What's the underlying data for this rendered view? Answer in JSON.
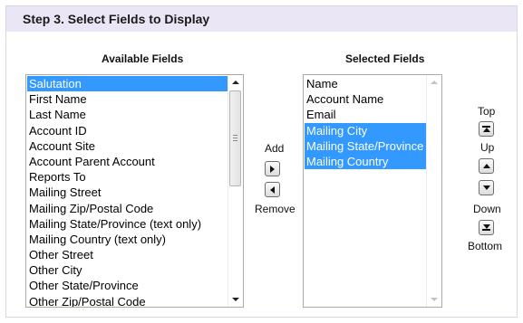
{
  "step": {
    "title": "Step 3. Select Fields to Display"
  },
  "available": {
    "title": "Available Fields",
    "items": [
      "Salutation",
      "First Name",
      "Last Name",
      "Account ID",
      "Account Site",
      "Account Parent Account",
      "Reports To",
      "Mailing Street",
      "Mailing Zip/Postal Code",
      "Mailing State/Province (text only)",
      "Mailing Country (text only)",
      "Other Street",
      "Other City",
      "Other State/Province",
      "Other Zip/Postal Code"
    ],
    "selected_indices": [
      0
    ]
  },
  "selected": {
    "title": "Selected Fields",
    "items": [
      "Name",
      "Account Name",
      "Email",
      "Mailing City",
      "Mailing State/Province",
      "Mailing Country"
    ],
    "selected_indices": [
      3,
      4,
      5
    ]
  },
  "buttons": {
    "add": "Add",
    "remove": "Remove",
    "top": "Top",
    "up": "Up",
    "down": "Down",
    "bottom": "Bottom"
  },
  "colors": {
    "header_bg": "#eae6f6",
    "selection": "#3399ff",
    "border": "#a9a9a9"
  },
  "icons": {
    "add": "right-arrow-icon",
    "remove": "left-arrow-icon",
    "top": "move-top-icon",
    "up": "move-up-icon",
    "down": "move-down-icon",
    "bottom": "move-bottom-icon"
  }
}
